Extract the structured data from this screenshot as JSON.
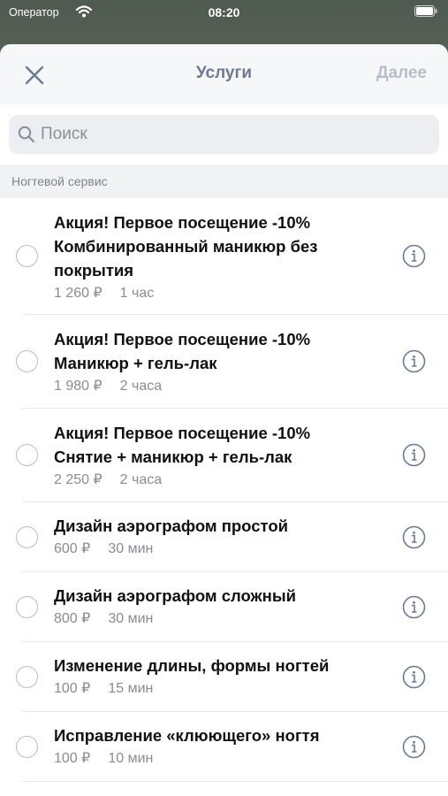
{
  "status_bar": {
    "carrier": "Оператор",
    "time": "08:20"
  },
  "nav": {
    "title": "Услуги",
    "next_label": "Далее"
  },
  "search": {
    "placeholder": "Поиск"
  },
  "section": {
    "title": "Ногтевой сервис"
  },
  "services": [
    {
      "title_lines": [
        "Акция! Первое посещение -10%",
        "Комбинированный маникюр без",
        "покрытия"
      ],
      "price": "1 260 ₽",
      "duration": "1 час"
    },
    {
      "title_lines": [
        "Акция! Первое посещение -10%",
        "Маникюр + гель-лак"
      ],
      "price": "1 980 ₽",
      "duration": "2 часа"
    },
    {
      "title_lines": [
        "Акция! Первое посещение -10%",
        "Снятие + маникюр + гель-лак"
      ],
      "price": "2 250 ₽",
      "duration": "2 часа"
    },
    {
      "title_lines": [
        "Дизайн аэрографом простой"
      ],
      "price": "600 ₽",
      "duration": "30 мин"
    },
    {
      "title_lines": [
        "Дизайн аэрографом сложный"
      ],
      "price": "800 ₽",
      "duration": "30 мин"
    },
    {
      "title_lines": [
        "Изменение длины, формы ногтей"
      ],
      "price": "100 ₽",
      "duration": "15 мин"
    },
    {
      "title_lines": [
        "Исправление «клюющего» ногтя"
      ],
      "price": "100 ₽",
      "duration": "10 мин"
    }
  ],
  "colors": {
    "accent": "#6c7a93",
    "disabled": "#b7bec9",
    "radio_border": "#b8bdc4"
  }
}
